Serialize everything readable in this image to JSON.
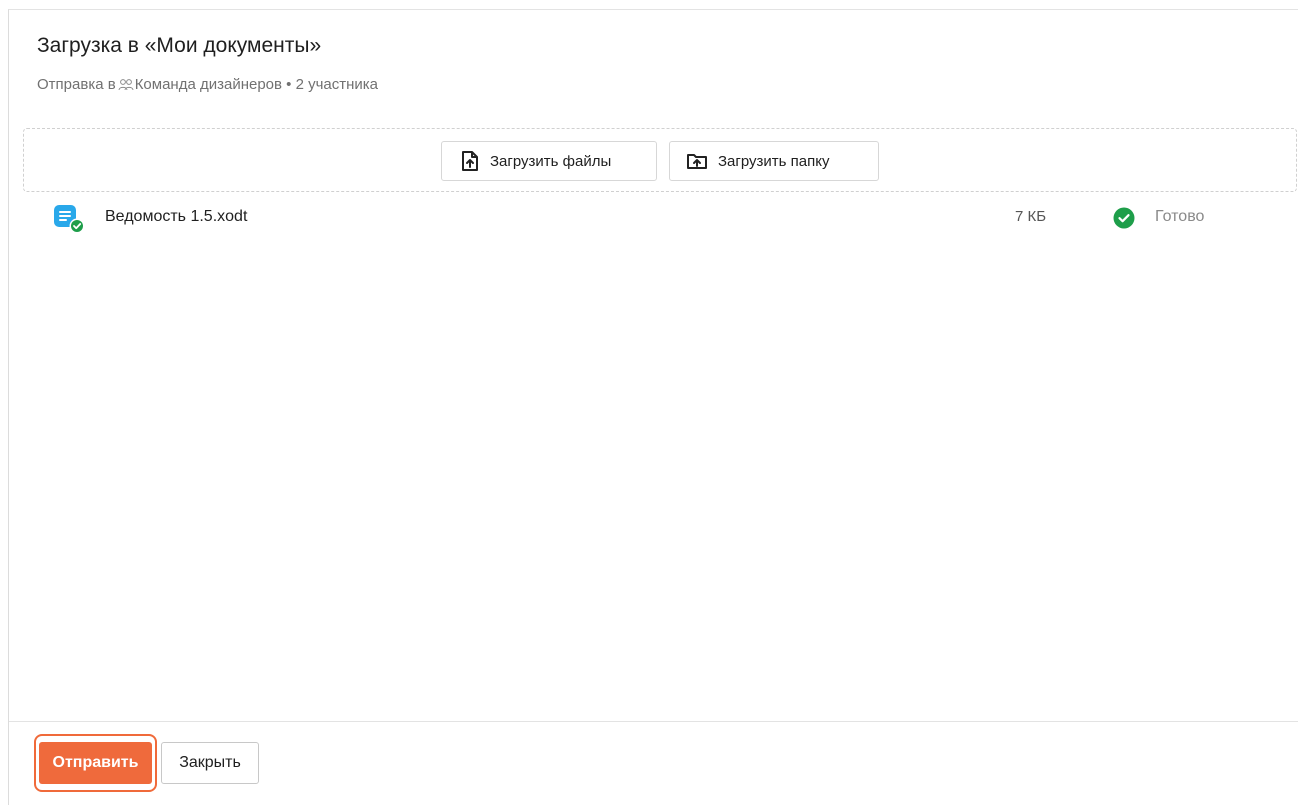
{
  "dialog": {
    "title": "Загрузка в «Мои документы»",
    "subtitle": {
      "prefix": "Отправка в",
      "group_icon": "group-icon",
      "group_name": "Команда дизайнеров",
      "separator": " • ",
      "members": "2 участника"
    }
  },
  "dropzone": {
    "upload_files_label": "Загрузить файлы",
    "upload_files_icon": "file-upload-icon",
    "upload_folder_label": "Загрузить папку",
    "upload_folder_icon": "folder-upload-icon"
  },
  "files": [
    {
      "name": "Ведомость 1.5.xodt",
      "size": "7 КБ",
      "status": "Готово",
      "icon": "document-icon",
      "status_icon": "check-circle-icon"
    }
  ],
  "footer": {
    "send_label": "Отправить",
    "close_label": "Закрыть"
  },
  "colors": {
    "accent": "#ef6a3c",
    "success": "#1e9e4a",
    "doc_icon": "#29a8ea"
  }
}
